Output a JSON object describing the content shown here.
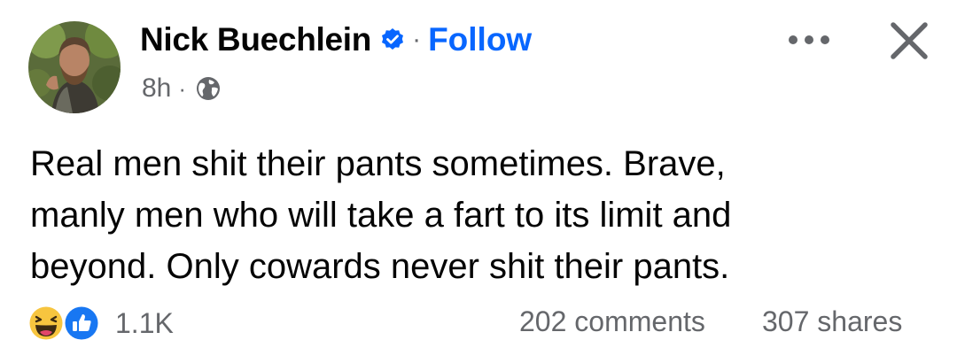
{
  "post": {
    "author": {
      "name": "Nick Buechlein",
      "verified_icon": "verified-badge-icon",
      "follow_label": "Follow",
      "separator": "·"
    },
    "meta": {
      "time": "8h",
      "separator": "·",
      "audience_icon": "globe-icon"
    },
    "body": "Real men shit their pants sometimes. Brave,\nmanly men who will take a fart to its limit and\nbeyond. Only cowards never shit their pants.",
    "actions": {
      "more_icon": "more-options-icon",
      "close_icon": "close-icon"
    },
    "reactions": {
      "icons": [
        "haha-reaction-icon",
        "like-reaction-icon"
      ],
      "count": "1.1K"
    },
    "comments": "202 comments",
    "shares": "307 shares"
  },
  "colors": {
    "accent": "#0866ff",
    "secondary_text": "#65676b",
    "primary_text": "#050505"
  }
}
